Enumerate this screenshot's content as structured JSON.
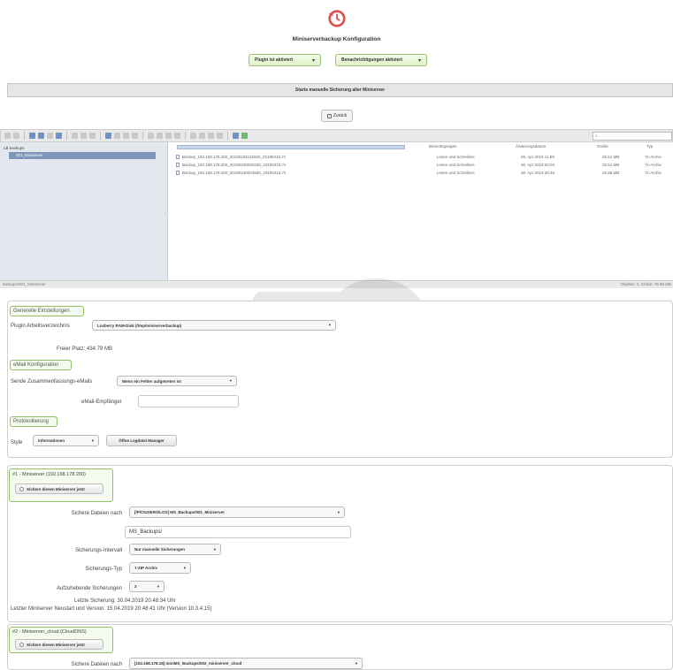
{
  "header": {
    "title": "Miniserverbackup Konfiguration",
    "plugin_status": "Plugin ist aktiviert",
    "notifications_status": "Benachrichtigungen aktiviert",
    "manual_backup_label": "Starte manuelle Sicherung aller Miniserver",
    "back_label": "Zurück"
  },
  "filemanager": {
    "search_placeholder": "",
    "tree_root": "LB backups",
    "tree_selected": "001_Miniserver",
    "columns": [
      "Berechtigungen",
      "Änderungsdatum",
      "Größe",
      "Typ"
    ],
    "files": [
      {
        "name": "Backup_192.168.178.200_20190425115925_20190415.7z",
        "perm": "Lesen und Schreiben",
        "date": "25. Apr 2019 11:59",
        "size": "25.51 MB",
        "type": "7z-Archiv"
      },
      {
        "name": "Backup_192.168.178.200_20190430020430_20190415.7z",
        "perm": "Lesen und Schreiben",
        "date": "30. Apr 2019 02:04",
        "size": "25.51 MB",
        "type": "7z-Archiv"
      },
      {
        "name": "Backup_192.168.178.200_20190430204830_20190415.7z",
        "perm": "Lesen und Schreiben",
        "date": "30. Apr 2019 20:48",
        "size": "25.88 MB",
        "type": "7z-Archiv"
      }
    ],
    "status_path": "backups/001_Miniserver",
    "status_objects": "Objekte: 3, Größe: 76.90 MB"
  },
  "general": {
    "legend": "Generelle Einstellungen",
    "workdir_label": "Plugin Arbeitsverzeichnis",
    "workdir_value": "Loxberry RAM-Disk (/tmp/miniserverbackup)",
    "free_space": "Freier Platz: 434.79 MB"
  },
  "email": {
    "legend": "eMail Konfiguration",
    "send_summary_label": "Sende Zusammenfassungs-eMails",
    "send_summary_value": "Wenn ein Fehler aufgetreten ist",
    "recipient_label": "eMail-Empfänger",
    "recipient_value": ""
  },
  "logging": {
    "legend": "Protokollierung",
    "style_label": "Style",
    "style_value": "Informationen",
    "open_logfile_label": "Öffne Logdatei Manager"
  },
  "ms1": {
    "legend": "#1 - Miniserver (192.168.178.200)",
    "backup_checkbox": "Sichere diesen Miniserver jetzt",
    "dest_label": "Sichere Dateien nach",
    "dest_value": "[/P/CIUSERS/LOX] MS_Backups/001_Miniserver",
    "subdir_value": "MS_Backups/",
    "interval_label": "Sicherungs-Intervall",
    "interval_value": "Nur manuelle Sicherungen",
    "type_label": "Sicherungs-Typ",
    "type_value": "7-ZIP Archiv",
    "retain_label": "Aufzuhebende Sicherungen",
    "retain_value": "3",
    "last_backup": "Letzte Sicherung: 30.04.2019 20:48:34 Uhr",
    "last_restart": "Letzter Miniserver Neustart und Version: 15.04.2019 20:48:41 Uhr (Version 10.3.4.15)"
  },
  "ms2": {
    "legend": "#2 - Miniserver_cloud (CloudDNS)",
    "backup_checkbox": "Sichere diesen Miniserver jetzt",
    "dest_label": "Sichere Dateien nach",
    "dest_value": "[192.168.178.18] miniMS_Backups/002_miniserver_cloud"
  }
}
